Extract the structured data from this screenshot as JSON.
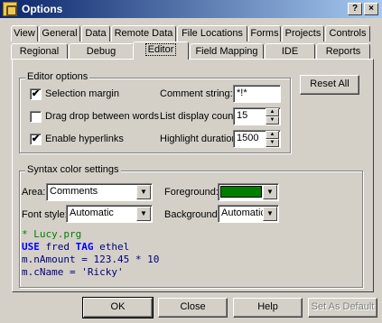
{
  "window": {
    "title": "Options",
    "help_btn": "?",
    "close_btn": "×"
  },
  "tabs_row1": [
    "View",
    "General",
    "Data",
    "Remote Data",
    "File Locations",
    "Forms",
    "Projects",
    "Controls"
  ],
  "tabs_row2": [
    "Regional",
    "Debug",
    "Editor",
    "Field Mapping",
    "IDE",
    "Reports"
  ],
  "active_tab": "Editor",
  "editor_options": {
    "legend": "Editor options",
    "selection_margin": {
      "label": "Selection margin",
      "checked": "✔"
    },
    "drag_drop": {
      "label": "Drag drop between words",
      "checked": ""
    },
    "hyperlinks": {
      "label": "Enable hyperlinks",
      "checked": "✔"
    },
    "comment_string_label": "Comment string:",
    "comment_string_value": "*!*",
    "list_display_count_label": "List display count:",
    "list_display_count_value": "15",
    "highlight_duration_label": "Highlight duration:",
    "highlight_duration_value": "1500",
    "reset_all": "Reset All"
  },
  "syntax": {
    "legend": "Syntax color settings",
    "area_label": "Area:",
    "area_value": "Comments",
    "font_style_label": "Font style:",
    "font_style_value": "Automatic",
    "foreground_label": "Foreground:",
    "foreground_color": "#008000",
    "background_label": "Background:",
    "background_value": "Automatic"
  },
  "code_sample": {
    "line1": "* Lucy.prg",
    "line2_kw1": "USE",
    "line2_mid": " fred ",
    "line2_kw2": "TAG",
    "line2_end": " ethel",
    "line3": "m.nAmount = 123.45 * 10",
    "line4": "m.cName = 'Ricky'"
  },
  "buttons": {
    "ok": "OK",
    "close": "Close",
    "help": "Help",
    "set_as_default": "Set As Default"
  }
}
